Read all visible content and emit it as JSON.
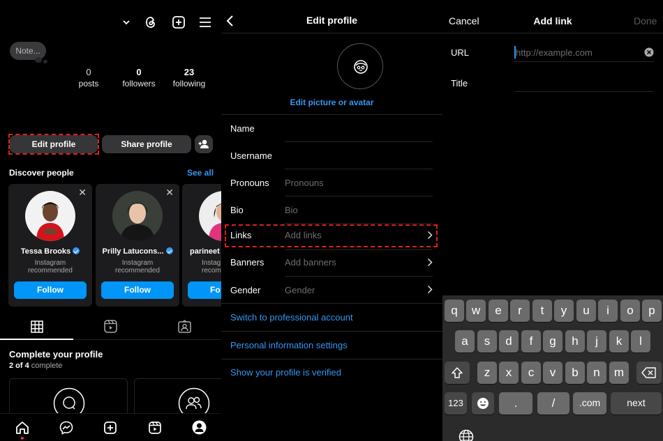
{
  "profile": {
    "note": "Note...",
    "stats": [
      {
        "num": "0",
        "label": "posts"
      },
      {
        "num": "0",
        "label": "followers"
      },
      {
        "num": "23",
        "label": "following"
      }
    ],
    "edit_profile": "Edit profile",
    "share_profile": "Share profile",
    "discover_title": "Discover people",
    "see_all": "See all",
    "cards": [
      {
        "name": "Tessa Brooks",
        "sub1": "Instagram",
        "sub2": "recommended",
        "follow": "Follow",
        "verified": true
      },
      {
        "name": "Prilly Latucons...",
        "sub1": "Instagram",
        "sub2": "recommended",
        "follow": "Follow",
        "verified": true
      },
      {
        "name": "parineet",
        "sub1": "Instag",
        "sub2": "recom",
        "follow": "Fo",
        "verified": false
      }
    ],
    "complete_title": "Complete your profile",
    "complete_count": "2 of 4",
    "complete_suffix": " complete"
  },
  "edit_profile": {
    "title": "Edit profile",
    "edit_picture": "Edit picture or avatar",
    "rows": [
      {
        "label": "Name",
        "value": ""
      },
      {
        "label": "Username",
        "value": ""
      },
      {
        "label": "Pronouns",
        "value": "Pronouns"
      },
      {
        "label": "Bio",
        "value": "Bio"
      },
      {
        "label": "Links",
        "value": "Add links"
      },
      {
        "label": "Banners",
        "value": "Add banners"
      },
      {
        "label": "Gender",
        "value": "Gender"
      }
    ],
    "switch_professional": "Switch to professional account",
    "personal_info": "Personal information settings",
    "show_verified": "Show your profile is verified"
  },
  "add_link": {
    "cancel": "Cancel",
    "title": "Add link",
    "done": "Done",
    "url_label": "URL",
    "url_placeholder": "http://example.com",
    "title_label": "Title"
  },
  "keyboard": {
    "row1": [
      "q",
      "w",
      "e",
      "r",
      "t",
      "y",
      "u",
      "i",
      "o",
      "p"
    ],
    "row2": [
      "a",
      "s",
      "d",
      "f",
      "g",
      "h",
      "j",
      "k",
      "l"
    ],
    "row3": [
      "z",
      "x",
      "c",
      "v",
      "b",
      "n",
      "m"
    ],
    "num_key": "123",
    "dot_key": ".",
    "slash_key": "/",
    "dotcom_key": ".com",
    "next_key": "next"
  },
  "colors": {
    "accent_blue": "#3797f0",
    "follow_blue": "#0095f6",
    "highlight_red": "#e0201b"
  }
}
